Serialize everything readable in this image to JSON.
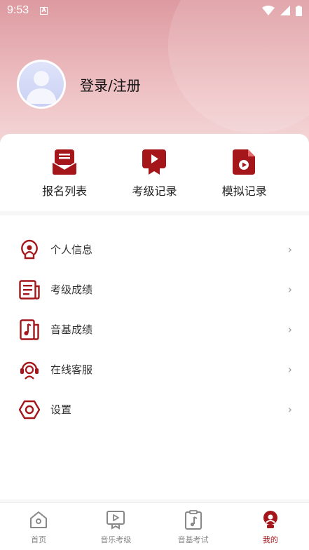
{
  "status_bar": {
    "time": "9:53",
    "notif_icon": "A"
  },
  "profile": {
    "login_label": "登录/注册"
  },
  "quick_actions": [
    {
      "label": "报名列表",
      "icon": "envelope-list-icon"
    },
    {
      "label": "考级记录",
      "icon": "play-ribbon-icon"
    },
    {
      "label": "模拟记录",
      "icon": "video-file-icon"
    }
  ],
  "menu": [
    {
      "label": "个人信息",
      "icon": "lightbulb-person-icon"
    },
    {
      "label": "考级成绩",
      "icon": "newspaper-icon"
    },
    {
      "label": "音基成绩",
      "icon": "music-note-file-icon"
    },
    {
      "label": "在线客服",
      "icon": "headset-icon"
    },
    {
      "label": "设置",
      "icon": "hexagon-gear-icon"
    }
  ],
  "tabs": [
    {
      "label": "首页",
      "icon": "home-icon",
      "active": false
    },
    {
      "label": "音乐考级",
      "icon": "play-board-icon",
      "active": false
    },
    {
      "label": "音基考试",
      "icon": "clipboard-note-icon",
      "active": false
    },
    {
      "label": "我的",
      "icon": "profile-icon",
      "active": true
    }
  ],
  "colors": {
    "accent": "#a4161a",
    "hero_top": "#dd9aa0",
    "inactive": "#888888"
  }
}
